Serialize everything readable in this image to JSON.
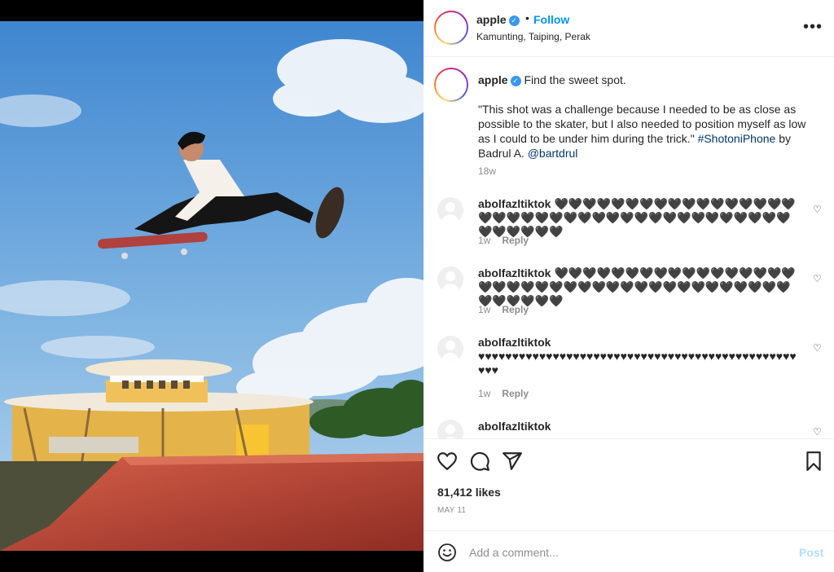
{
  "post": {
    "username": "apple",
    "location": "Kamunting, Taiping, Perak",
    "follow_label": "Follow",
    "separator": "•",
    "more_icon": "more-horizontal-icon",
    "avatar_icon": "apple-logo-icon"
  },
  "caption": {
    "username": "apple",
    "headline": "Find the sweet spot.",
    "quote": "\"This shot was a challenge because I needed to be as close as possible to the skater, but I also needed to position myself as low as I could to be under him during the trick.\"",
    "hashtag": "#ShotoniPhone",
    "by_text": "by Badrul A.",
    "mention": "@bartdrul",
    "time": "18w"
  },
  "comments": [
    {
      "username": "abolfazltiktok",
      "text": "🖤🖤🖤🖤🖤🖤🖤🖤🖤🖤🖤🖤🖤🖤🖤🖤🖤🖤🖤🖤🖤🖤🖤🖤🖤🖤🖤🖤🖤🖤🖤🖤🖤🖤🖤🖤🖤🖤🖤🖤🖤🖤🖤🖤🖤",
      "time": "1w",
      "reply": "Reply"
    },
    {
      "username": "abolfazltiktok",
      "text": "🖤🖤🖤🖤🖤🖤🖤🖤🖤🖤🖤🖤🖤🖤🖤🖤🖤🖤🖤🖤🖤🖤🖤🖤🖤🖤🖤🖤🖤🖤🖤🖤🖤🖤🖤🖤🖤🖤🖤🖤🖤🖤🖤🖤🖤",
      "time": "1w",
      "reply": "Reply"
    },
    {
      "username": "abolfazltiktok",
      "text": "♥♥♥♥♥♥♥♥♥♥♥♥♥♥♥♥♥♥♥♥♥♥♥♥♥♥♥♥♥♥♥♥♥♥♥♥♥♥♥♥♥♥♥♥♥♥♥♥♥♥",
      "time": "1w",
      "reply": "Reply"
    },
    {
      "username": "abolfazltiktok",
      "text": "",
      "time": "",
      "reply": ""
    }
  ],
  "actions": {
    "likes": "81,412 likes",
    "date": "MAY 11",
    "icons": [
      "heart-icon",
      "comment-icon",
      "share-icon",
      "bookmark-icon"
    ]
  },
  "add_comment": {
    "placeholder": "Add a comment...",
    "post_label": "Post",
    "emoji_icon": "emoji-smile-icon"
  },
  "colors": {
    "accent": "#0095f6",
    "verified": "#3897f0",
    "post_disabled": "#b2dffc",
    "muted": "#8e8e8e",
    "sky": "#6aa5dc",
    "ramp": "#c2523e"
  }
}
